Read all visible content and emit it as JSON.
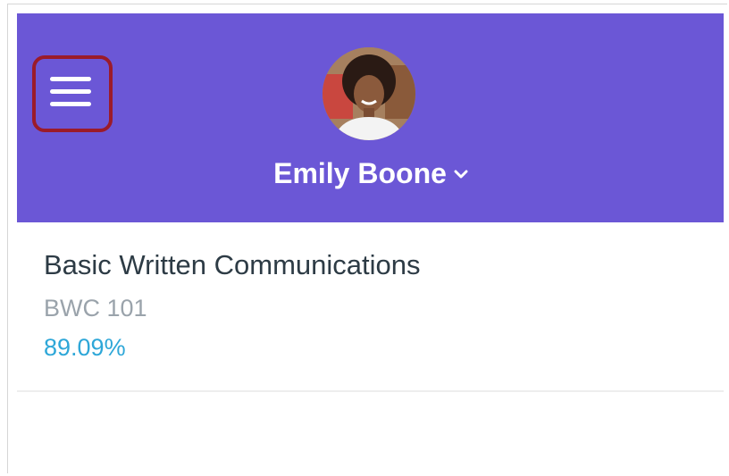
{
  "header": {
    "background_color": "#6b57d6",
    "menu_icon": "hamburger-menu-icon",
    "highlight_color": "#9b1b2a",
    "user_name": "Emily Boone",
    "dropdown_icon": "chevron-down-icon"
  },
  "courses": [
    {
      "title": "Basic Written Communications",
      "code": "BWC 101",
      "grade": "89.09%"
    }
  ],
  "colors": {
    "title": "#2d3b45",
    "code": "#9aa3ab",
    "grade": "#2ea7d8"
  }
}
